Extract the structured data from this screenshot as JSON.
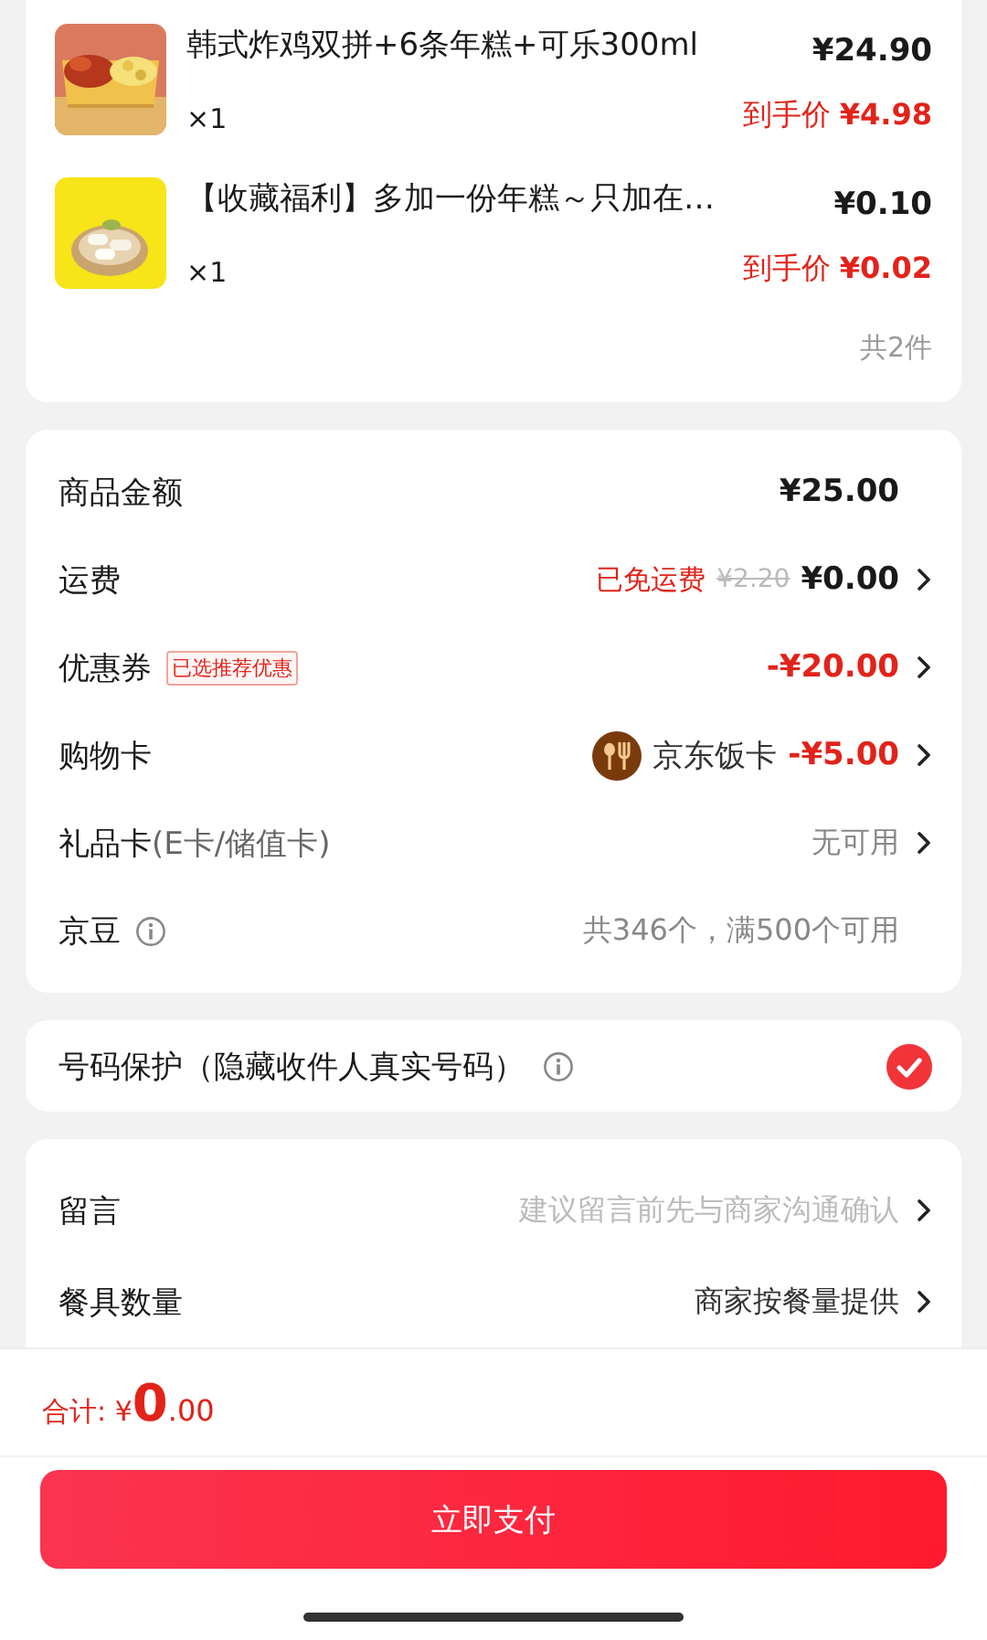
{
  "products": [
    {
      "title": "韩式炸鸡双拼+6条年糕+可乐300ml",
      "quantity": "×1",
      "price": "¥24.90",
      "final_label": "到手价",
      "final_price": "¥4.98"
    },
    {
      "title": "【收藏福利】多加一份年糕～只加在…",
      "quantity": "×1",
      "price": "¥0.10",
      "final_label": "到手价",
      "final_price": "¥0.02"
    }
  ],
  "item_count": "共2件",
  "summary": [
    {
      "label": "商品金额",
      "values": [
        {
          "kind": "price",
          "text": "¥25.00"
        }
      ],
      "chevron": false
    },
    {
      "label": "运费",
      "values": [
        {
          "kind": "note-red",
          "text": "已免运费"
        },
        {
          "kind": "strike",
          "text": "¥2.20"
        },
        {
          "kind": "price",
          "text": "¥0.00"
        }
      ],
      "chevron": true
    },
    {
      "label": "优惠券",
      "tag": "已选推荐优惠",
      "values": [
        {
          "kind": "discount",
          "text": "-¥20.00"
        }
      ],
      "chevron": true
    },
    {
      "label": "购物卡",
      "values": [
        {
          "kind": "card",
          "text": "京东饭卡"
        },
        {
          "kind": "discount",
          "text": "-¥5.00"
        }
      ],
      "chevron": true
    },
    {
      "label": "礼品卡",
      "sublabel": "(E卡/储值卡)",
      "values": [
        {
          "kind": "muted",
          "text": "无可用"
        }
      ],
      "chevron": true
    },
    {
      "label": "京豆",
      "info": true,
      "values": [
        {
          "kind": "muted",
          "text": "共346个，满500个可用"
        }
      ],
      "chevron": false
    }
  ],
  "privacy": {
    "label": "号码保护（隐藏收件人真实号码）",
    "info": true,
    "checked": true
  },
  "options": [
    {
      "label": "留言",
      "placeholder": "建议留言前先与商家沟通确认",
      "chevron": true
    },
    {
      "label": "餐具数量",
      "value": "商家按餐量提供",
      "chevron": true
    }
  ],
  "footer": {
    "total_label": "合计:",
    "currency": "¥",
    "amount_integer": "0",
    "amount_decimal": ".00",
    "pay_button": "立即支付"
  }
}
